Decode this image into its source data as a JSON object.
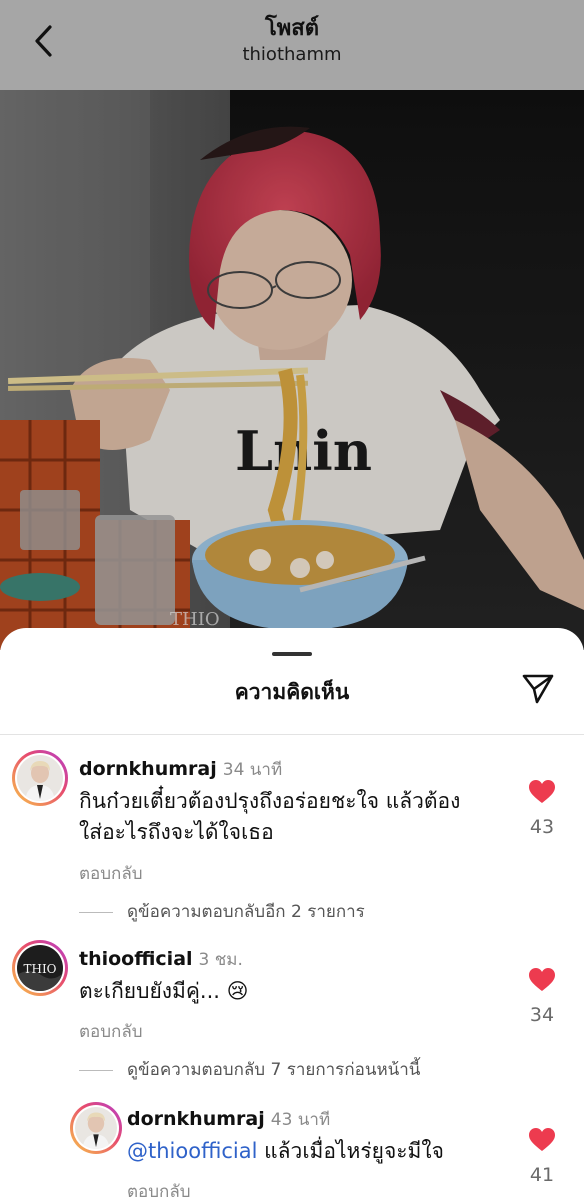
{
  "header": {
    "title": "โพสต์",
    "username": "thiothamm"
  },
  "photo": {
    "watermark": "THIO"
  },
  "comments_sheet": {
    "title": "ความคิดเห็น",
    "comments": [
      {
        "username": "dornkhumraj",
        "time": "34 นาที",
        "text_line1": "กินก๋วยเตี๋ยวต้องปรุงถึงอร่อยชะใจ แล้วต้อง",
        "text_line2": "ใส่อะไรถึงจะได้ใจเธอ",
        "reply_label": "ตอบกลับ",
        "likes": "43",
        "view_replies": "ดูข้อความตอบกลับอีก 2 รายการ"
      },
      {
        "username": "thioofficial",
        "time": "3 ชม.",
        "text": "ตะเกียบยังมีคู่... 😢",
        "reply_label": "ตอบกลับ",
        "likes": "34",
        "view_replies": "ดูข้อความตอบกลับ 7 รายการก่อนหน้านี้",
        "avatar_text": "THIO"
      },
      {
        "username": "dornkhumraj",
        "time": "43 นาที",
        "mention": "@thioofficial",
        "text": " แล้วเมื่อไหร่ยูจะมีใจ",
        "reply_label": "ตอบกลับ",
        "likes": "41"
      }
    ]
  },
  "colors": {
    "like_red": "#ed3b4f",
    "mention_blue": "#2f62c9",
    "story_ring": [
      "#f9c44a",
      "#e64a6f",
      "#b23dd1"
    ]
  },
  "icons": [
    "back-chevron-icon",
    "share-send-icon",
    "heart-icon"
  ]
}
